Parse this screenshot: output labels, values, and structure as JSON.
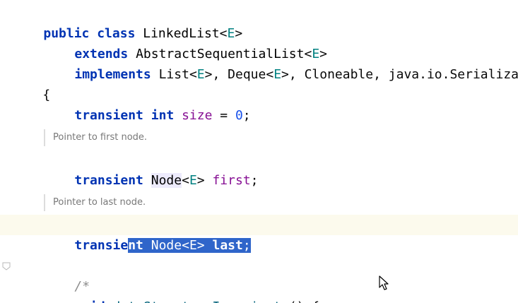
{
  "code": {
    "l1": {
      "kw": "public class ",
      "cls": "LinkedList",
      "lt": "<",
      "tp": "E",
      "gt": ">"
    },
    "l2": {
      "kw": "extends ",
      "cls": "AbstractSequentialList",
      "lt": "<",
      "tp": "E",
      "gt": ">"
    },
    "l3": {
      "kw": "implements ",
      "p1": "List",
      "t1": "E",
      "p2": "Deque",
      "t2": "E",
      "p3": "Cloneable, java.io.Serializable",
      "lt": "<",
      "gt": ">",
      "sep": ", "
    },
    "l4": {
      "brace": "{"
    },
    "l5": {
      "kw": "transient int ",
      "fld": "size",
      "eq": " = ",
      "num": "0",
      "semi": ";"
    },
    "doc1": "Pointer to first node.",
    "l6": {
      "kw": "transient ",
      "node": "Node",
      "lt": "<",
      "tp": "E",
      "gt": "> ",
      "fld": "first",
      "semi": ";"
    },
    "doc2": "Pointer to last node.",
    "l7": {
      "kw_a": "transie",
      "kw_b": "nt",
      "sp": " ",
      "node": "Node",
      "lt": "<",
      "tp": "E",
      "gt": "> ",
      "fld": "last",
      "semi": ";"
    },
    "l8": {
      "cmt": "/*"
    },
    "l9": {
      "kw": "void ",
      "name": "dataStructureInvariants",
      "rest": "() {"
    }
  },
  "icons": {
    "fold": "fold-marker-icon",
    "cursor": "mouse-pointer-icon"
  }
}
